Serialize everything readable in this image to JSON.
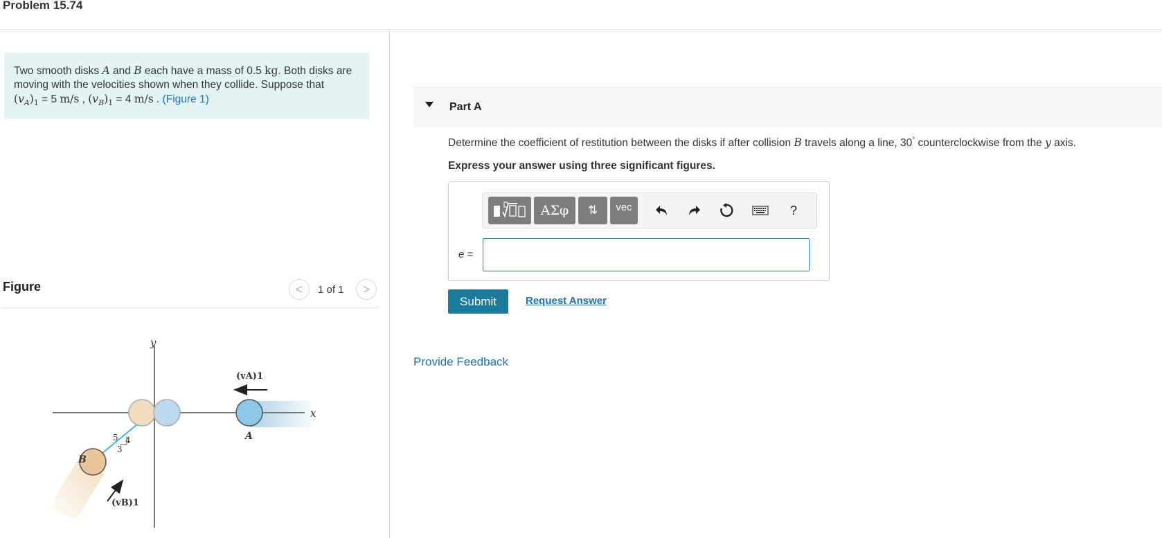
{
  "title": "Problem 15.74",
  "problem": {
    "t1": "Two smooth disks ",
    "a": "A",
    "t2": " and ",
    "b": "B",
    "t3": " each have a mass of 0.5 ",
    "kg": "kg",
    "t4": ". Both disks are moving with the velocities shown when they collide. Suppose that",
    "vA": "(vA)1",
    "eq1": " = 5 ",
    "unit1": "m/s",
    "comma": " , ",
    "vB": "(vB)1",
    "eq2": " = 4 ",
    "unit2": "m/s",
    "t5": " . ",
    "figure_link": "(Figure 1)"
  },
  "figure": {
    "label": "Figure",
    "count": "1 of 1",
    "prev_glyph": "<",
    "next_glyph": ">",
    "labels": {
      "y": "y",
      "x": "x",
      "vA": "(vA)1",
      "A": "A",
      "B": "B",
      "vB": "(vB)1",
      "n5": "5",
      "n4": "4",
      "n3": "3"
    }
  },
  "part_a": {
    "title": "Part A",
    "question": {
      "t1": "Determine the coefficient of restitution between the disks if after collision ",
      "b": "B",
      "t2": " travels along a line, 30",
      "deg": "°",
      "t3": " counterclockwise from the ",
      "y": "y",
      "t4": " axis."
    },
    "instruction": "Express your answer using three significant figures.",
    "toolbar": {
      "greek": "ΑΣφ",
      "arrows": "⇅",
      "vec": "vec",
      "undo": "↶",
      "redo": "↷",
      "help": "?"
    },
    "answer": {
      "label": "e",
      "eq": " =",
      "value": ""
    },
    "submit_label": "Submit",
    "request_answer": "Request Answer"
  },
  "feedback": "Provide Feedback"
}
